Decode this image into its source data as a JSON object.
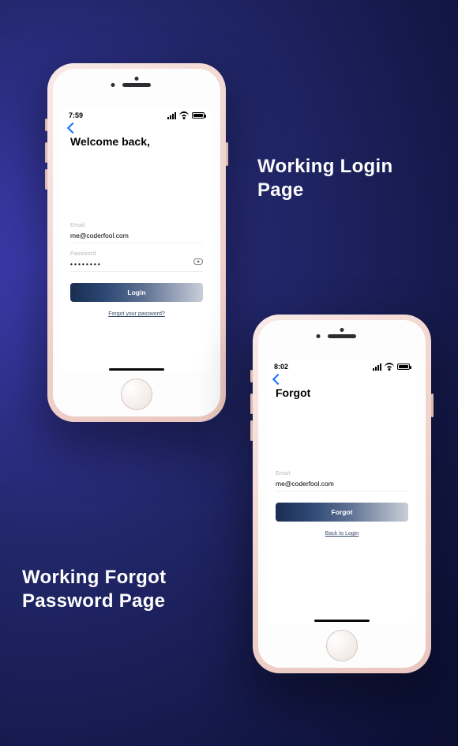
{
  "headlines": {
    "login": "Working Login\nPage",
    "forgot": "Working Forgot\nPassword Page"
  },
  "login_screen": {
    "status_time": "7:59",
    "title": "Welcome back,",
    "email_label": "Email",
    "email_value": "me@coderfool.com",
    "password_label": "Password",
    "password_value": "••••••••",
    "button": "Login",
    "link": "Forgot your password?"
  },
  "forgot_screen": {
    "status_time": "8:02",
    "title": "Forgot",
    "email_label": "Email",
    "email_value": "me@coderfool.com",
    "button": "Forgot",
    "link": "Back to Login"
  }
}
